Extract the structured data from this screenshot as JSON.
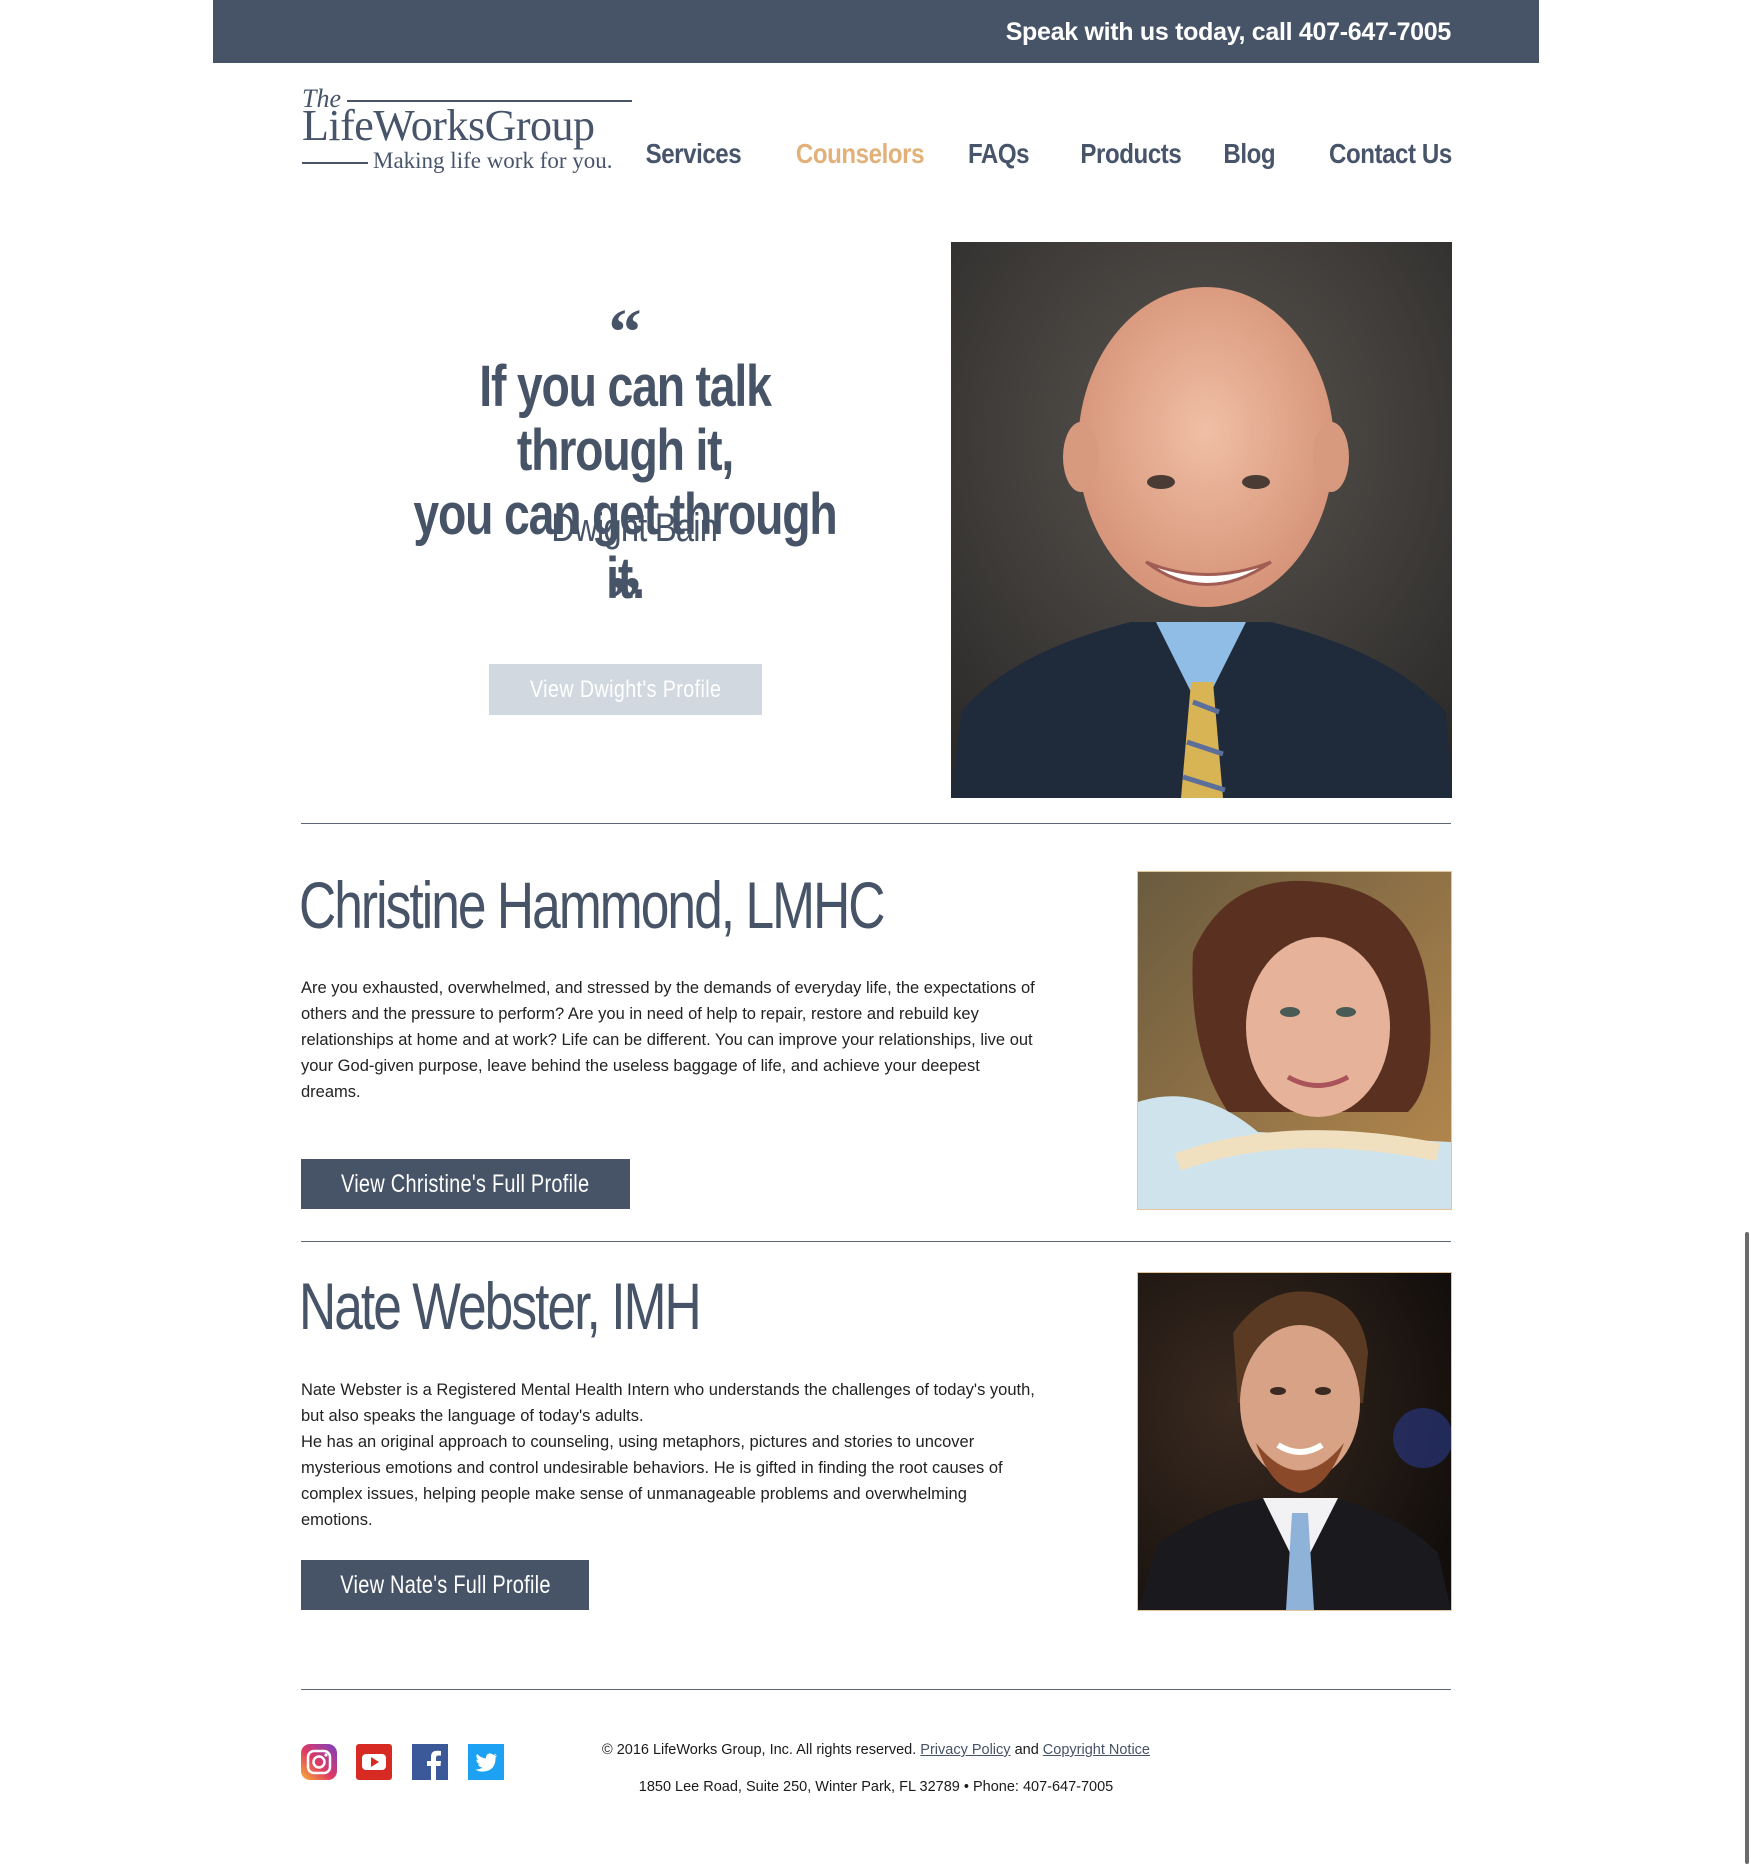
{
  "topbar": {
    "phone_text": "Speak with us today, call 407-647-7005"
  },
  "logo": {
    "the": "The",
    "name": "LifeWorksGroup",
    "tagline": "Making life work for you."
  },
  "nav": [
    {
      "label": "Services",
      "active": false
    },
    {
      "label": "Counselors",
      "active": true
    },
    {
      "label": "FAQs",
      "active": false
    },
    {
      "label": "Products",
      "active": false
    },
    {
      "label": "Blog",
      "active": false
    },
    {
      "label": "Contact Us",
      "active": false
    }
  ],
  "hero": {
    "open_quote": "“",
    "quote_line1": "If you can talk through it,",
    "quote_line2": "you can get through it.",
    "author": "- Dwight Bain",
    "close_quote": "”",
    "button": "View Dwight's Profile"
  },
  "counselors": [
    {
      "name": "Christine Hammond, LMHC",
      "bio": [
        "Are you exhausted, overwhelmed, and stressed by the demands of everyday life, the expectations of others and the pressure to perform? Are you in need of help to repair, restore and rebuild key relationships at home and at work? Life can be different. You can improve your relationships, live out your God-given purpose, leave behind the useless baggage of life, and achieve your deepest dreams."
      ],
      "button": "View Christine's Full Profile"
    },
    {
      "name": "Nate Webster, IMH",
      "bio": [
        "Nate Webster is a Registered Mental Health Intern who understands the challenges of today's youth, but also speaks the language of today's adults.",
        "He has an original approach to counseling, using metaphors, pictures and stories to uncover mysterious emotions and control undesirable behaviors. He is gifted in finding the root causes of complex issues, helping people make sense of unmanageable problems and overwhelming emotions."
      ],
      "button": "View Nate's Full Profile"
    }
  ],
  "footer": {
    "social_icons": [
      "instagram-icon",
      "youtube-icon",
      "facebook-icon",
      "twitter-icon"
    ],
    "copyright": "© 2016 LifeWorks Group, Inc. All rights reserved.",
    "privacy": "Privacy Policy",
    "and": "and",
    "copyright_notice": "Copyright Notice",
    "address": "1850 Lee Road, Suite 250, Winter Park, FL 32789 • Phone: 407-647-7005"
  },
  "colors": {
    "slate": "#475467",
    "accent": "#e1b179",
    "light_button": "#d1d8df"
  }
}
